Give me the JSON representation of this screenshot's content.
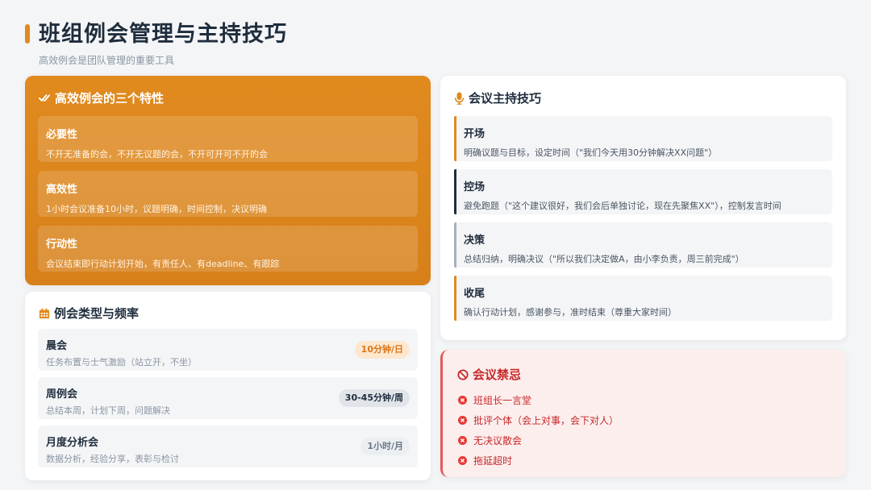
{
  "page": {
    "title": "班组例会管理与主持技巧",
    "subtitle": "高效例会是团队管理的重要工具"
  },
  "features": {
    "title": "高效例会的三个特性",
    "icon": "double-check-icon",
    "items": [
      {
        "name": "必要性",
        "desc": "不开无准备的会，不开无议题的会，不开可开可不开的会"
      },
      {
        "name": "高效性",
        "desc": "1小时会议准备10小时，议题明确，时间控制，决议明确"
      },
      {
        "name": "行动性",
        "desc": "会议结束即行动计划开始，有责任人、有deadline、有跟踪"
      }
    ]
  },
  "types": {
    "title": "例会类型与频率",
    "icon": "calendar-icon",
    "items": [
      {
        "name": "晨会",
        "desc": "任务布置与士气激励（站立开，不坐）",
        "badge": "10分钟/日",
        "badge_bg": "#fde7cf",
        "badge_color": "#d9761a"
      },
      {
        "name": "周例会",
        "desc": "总结本周，计划下周，问题解决",
        "badge": "30-45分钟/周",
        "badge_bg": "#e1e5ea",
        "badge_color": "#1f2d3d"
      },
      {
        "name": "月度分析会",
        "desc": "数据分析，经验分享，表彰与检讨",
        "badge": "1小时/月",
        "badge_bg": "#eceff2",
        "badge_color": "#6b7785"
      }
    ]
  },
  "skills": {
    "title": "会议主持技巧",
    "icon": "microphone-icon",
    "items": [
      {
        "name": "开场",
        "desc": "明确议题与目标，设定时间（\"我们今天用30分钟解决XX问题\"）",
        "bar": "#e08a1e"
      },
      {
        "name": "控场",
        "desc": "避免跑题（\"这个建议很好，我们会后单独讨论，现在先聚焦XX\"），控制发言时间",
        "bar": "#1f2d3d"
      },
      {
        "name": "决策",
        "desc": "总结归纳，明确决议（\"所以我们决定做A，由小李负责，周三前完成\"）",
        "bar": "#a7b0ba"
      },
      {
        "name": "收尾",
        "desc": "确认行动计划，感谢参与，准时结束（尊重大家时间）",
        "bar": "#e08a1e"
      }
    ]
  },
  "taboos": {
    "title": "会议禁忌",
    "icon": "prohibited-icon",
    "items": [
      {
        "text": "班组长一言堂"
      },
      {
        "text": "批评个体（会上对事，会下对人）"
      },
      {
        "text": "无决议散会"
      },
      {
        "text": "拖延超时"
      }
    ]
  },
  "colors": {
    "accent": "#e08a1e",
    "danger": "#c62828",
    "dark": "#1f2d3d"
  }
}
